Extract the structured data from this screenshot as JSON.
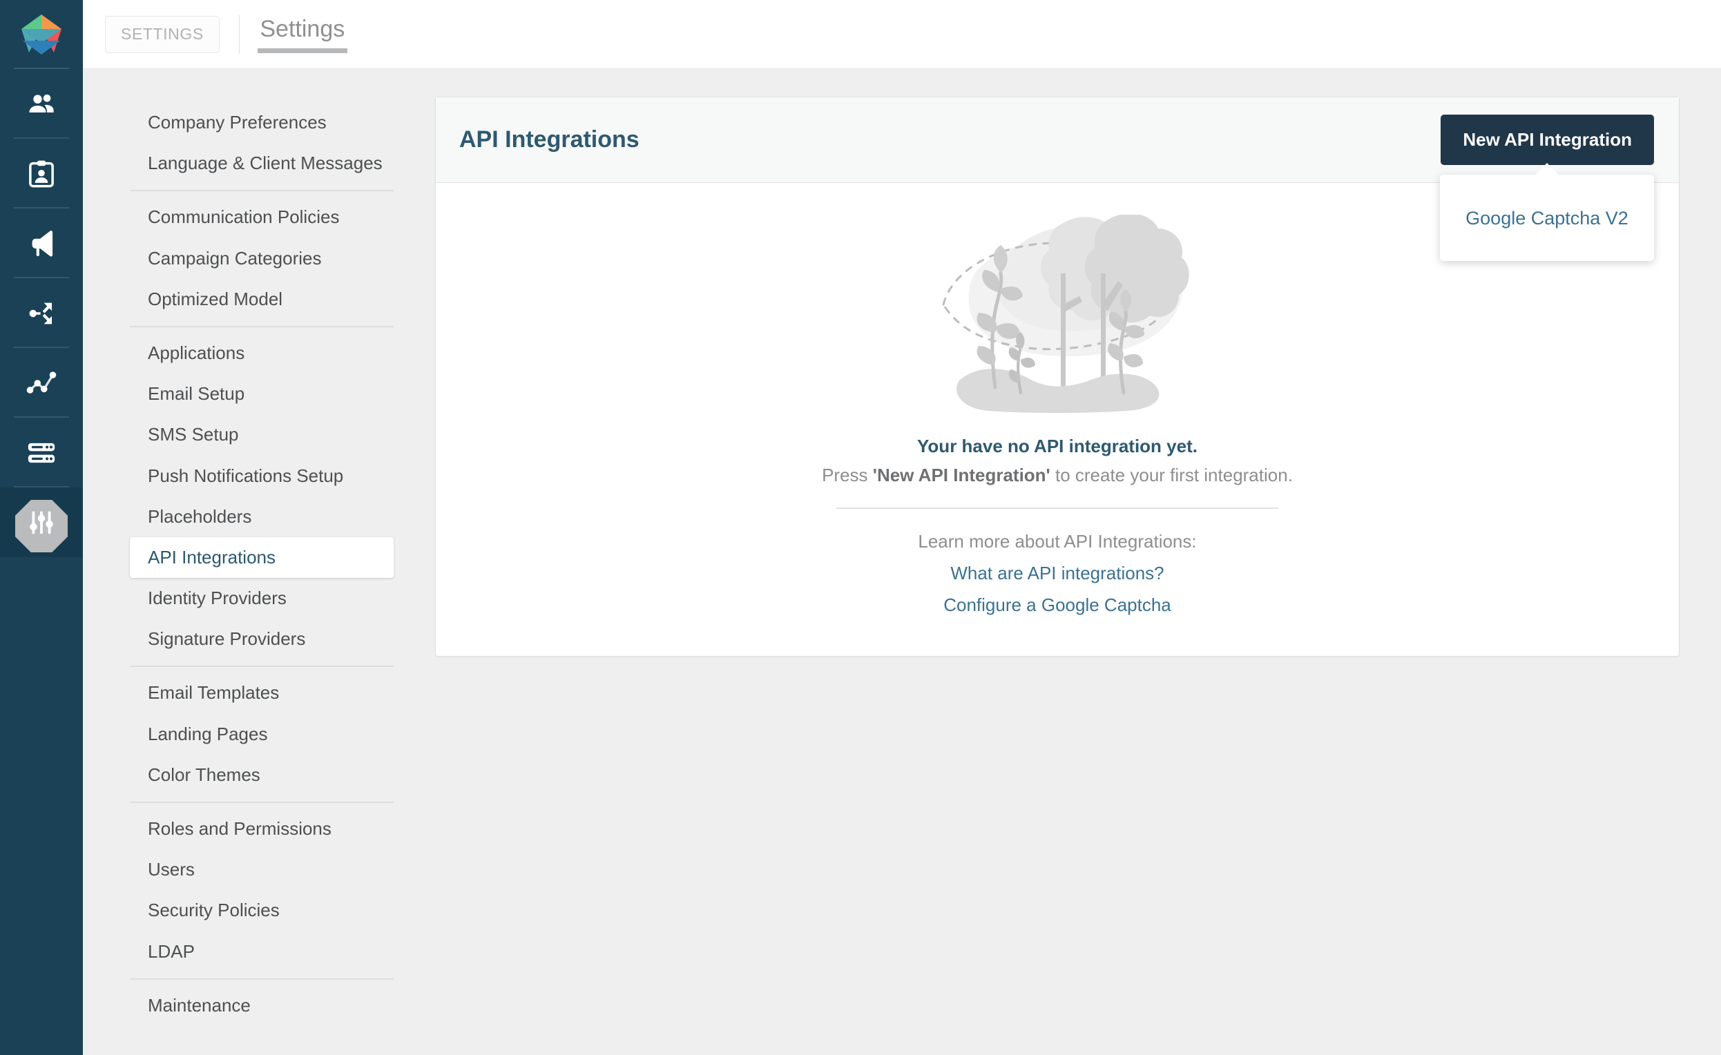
{
  "brand": {
    "logo_icon": "gem-pentagon-logo",
    "colors": {
      "rail_bg": "#1a4156",
      "accent_dark": "#20374a",
      "link": "#3b7192",
      "title": "#2e5970",
      "page_bg": "#efefef"
    }
  },
  "rail": {
    "items": [
      {
        "icon": "users-icon",
        "name": "contacts"
      },
      {
        "icon": "clipboard-user-icon",
        "name": "clients"
      },
      {
        "icon": "megaphone-icon",
        "name": "campaigns"
      },
      {
        "icon": "share-nodes-icon",
        "name": "workflows"
      },
      {
        "icon": "line-chart-icon",
        "name": "analytics"
      },
      {
        "icon": "server-icon",
        "name": "data"
      },
      {
        "icon": "sliders-icon",
        "name": "settings"
      }
    ]
  },
  "topbar": {
    "badge": "SETTINGS",
    "tab": "Settings"
  },
  "nav": {
    "groups": [
      {
        "items": [
          {
            "label": "Company Preferences",
            "active": false
          },
          {
            "label": "Language & Client Messages",
            "active": false
          }
        ]
      },
      {
        "items": [
          {
            "label": "Communication Policies",
            "active": false
          },
          {
            "label": "Campaign Categories",
            "active": false
          },
          {
            "label": "Optimized Model",
            "active": false
          }
        ]
      },
      {
        "items": [
          {
            "label": "Applications",
            "active": false
          },
          {
            "label": "Email Setup",
            "active": false
          },
          {
            "label": "SMS Setup",
            "active": false
          },
          {
            "label": "Push Notifications Setup",
            "active": false
          },
          {
            "label": "Placeholders",
            "active": false
          },
          {
            "label": "API Integrations",
            "active": true
          },
          {
            "label": "Identity Providers",
            "active": false
          },
          {
            "label": "Signature Providers",
            "active": false
          }
        ]
      },
      {
        "items": [
          {
            "label": "Email Templates",
            "active": false
          },
          {
            "label": "Landing Pages",
            "active": false
          },
          {
            "label": "Color Themes",
            "active": false
          }
        ]
      },
      {
        "items": [
          {
            "label": "Roles and Permissions",
            "active": false
          },
          {
            "label": "Users",
            "active": false
          },
          {
            "label": "Security Policies",
            "active": false
          },
          {
            "label": "LDAP",
            "active": false
          }
        ]
      },
      {
        "items": [
          {
            "label": "Maintenance",
            "active": false
          }
        ]
      }
    ]
  },
  "panel": {
    "title": "API Integrations",
    "new_button": "New API Integration",
    "dropdown": {
      "open": true,
      "items": [
        "Google Captcha V2"
      ]
    },
    "empty_state": {
      "illustration": "trees-and-plants-illustration",
      "title": "Your have no API integration yet.",
      "subtitle_prefix": "Press ",
      "subtitle_bold": "'New API Integration'",
      "subtitle_suffix": " to create your first integration.",
      "learn_more_label": "Learn more about API Integrations:",
      "links": [
        "What are API integrations?",
        "Configure a Google Captcha"
      ]
    }
  }
}
